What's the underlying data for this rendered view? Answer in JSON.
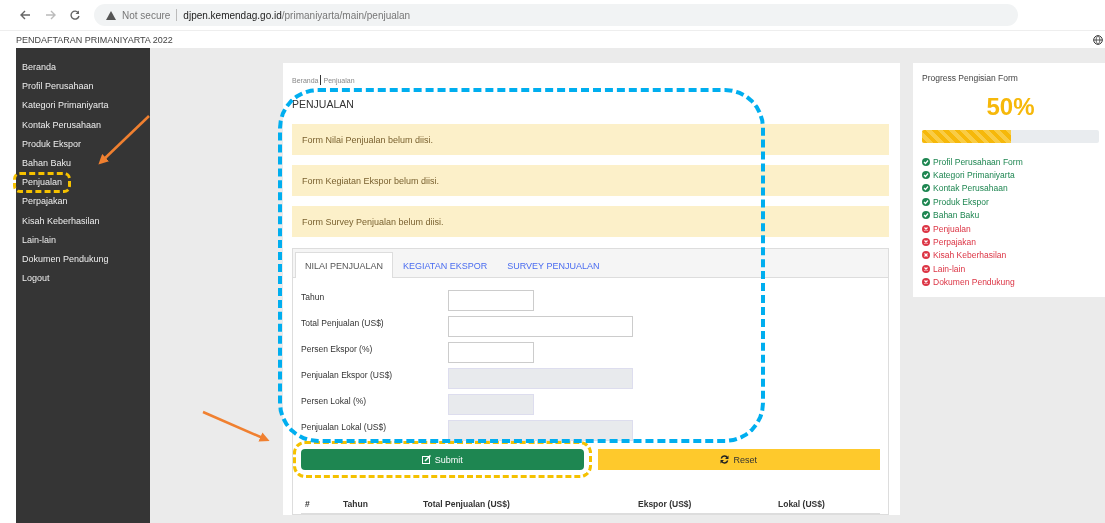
{
  "browser": {
    "security_label": "Not secure",
    "url": "**djpen.kemendag.go.id**/primaniyarta/main/penjualan"
  },
  "app_title": "PENDAFTARAN PRIMANIYARTA 2022",
  "sidebar": {
    "items": [
      {
        "label": "Beranda",
        "highlighted": false
      },
      {
        "label": "Profil Perusahaan",
        "highlighted": false
      },
      {
        "label": "Kategori Primaniyarta",
        "highlighted": false
      },
      {
        "label": "Kontak Perusahaan",
        "highlighted": false
      },
      {
        "label": "Produk Ekspor",
        "highlighted": false
      },
      {
        "label": "Bahan Baku",
        "highlighted": false
      },
      {
        "label": "Penjualan",
        "highlighted": true
      },
      {
        "label": "Perpajakan",
        "highlighted": false
      },
      {
        "label": "Kisah Keberhasilan",
        "highlighted": false
      },
      {
        "label": "Lain-lain",
        "highlighted": false
      },
      {
        "label": "Dokumen Pendukung",
        "highlighted": false
      },
      {
        "label": "Logout",
        "highlighted": false
      }
    ]
  },
  "breadcrumb": [
    "Beranda",
    "Penjualan"
  ],
  "page_title": "PENJUALAN",
  "form_area_highlighted": true,
  "alerts": [
    "Form Nilai Penjualan belum diisi.",
    "Form Kegiatan Ekspor belum diisi.",
    "Form Survey Penjualan belum diisi."
  ],
  "tabs": [
    {
      "label": "NILAI PENJUALAN",
      "selected": true
    },
    {
      "label": "KEGIATAN EKSPOR",
      "selected": false
    },
    {
      "label": "SURVEY PENJUALAN",
      "selected": false
    }
  ],
  "form": {
    "fields": [
      {
        "label": "Tahun",
        "kind": "short",
        "disabled": false
      },
      {
        "label": "Total Penjualan (US$)",
        "kind": "long",
        "disabled": false
      },
      {
        "label": "Persen Ekspor (%)",
        "kind": "short",
        "disabled": false
      },
      {
        "label": "Penjualan Ekspor (US$)",
        "kind": "long",
        "disabled": true
      },
      {
        "label": "Persen Lokal (%)",
        "kind": "short",
        "disabled": true
      },
      {
        "label": "Penjualan Lokal (US$)",
        "kind": "long",
        "disabled": true
      }
    ]
  },
  "buttons": [
    {
      "label": "Submit",
      "kind": "submit",
      "highlighted": true
    },
    {
      "label": "Reset",
      "kind": "reset",
      "highlighted": false
    }
  ],
  "table": {
    "columns": [
      "#",
      "Tahun",
      "Total Penjualan (US$)",
      "Ekspor (US$)",
      "Lokal (US$)"
    ]
  },
  "progress": {
    "title": "Progress Pengisian Form",
    "percent": "50%",
    "level": 0.5,
    "items": [
      {
        "label": "Profil Perusahaan Form",
        "done": true
      },
      {
        "label": "Kategori Primaniyarta",
        "done": true
      },
      {
        "label": "Kontak Perusahaan",
        "done": true
      },
      {
        "label": "Produk Ekspor",
        "done": true
      },
      {
        "label": "Bahan Baku",
        "done": true
      },
      {
        "label": "Penjualan",
        "done": false
      },
      {
        "label": "Perpajakan",
        "done": false
      },
      {
        "label": "Kisah Keberhasilan",
        "done": false
      },
      {
        "label": "Lain-lain",
        "done": false
      },
      {
        "label": "Dokumen Pendukung",
        "done": false
      }
    ]
  }
}
